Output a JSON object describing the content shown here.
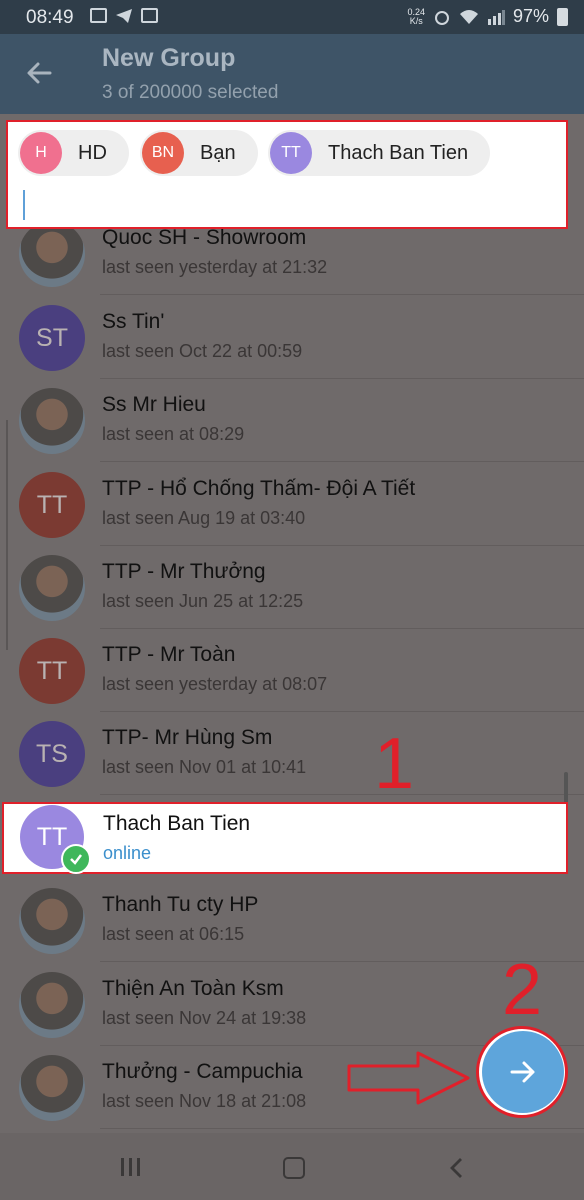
{
  "status_bar": {
    "time": "08:49",
    "speed_value": "0.24",
    "speed_unit": "K/s",
    "battery": "97%"
  },
  "app_bar": {
    "title": "New Group",
    "subtitle": "3 of 200000 selected"
  },
  "chips": [
    {
      "initials": "H",
      "label": "HD",
      "color": "#f0708f"
    },
    {
      "initials": "BN",
      "label": "Bạn",
      "color": "#e7604f"
    },
    {
      "initials": "TT",
      "label": "Thach Ban Tien",
      "color": "#9a88e0"
    }
  ],
  "contacts": [
    {
      "name": "Quoc SH - Showroom",
      "status": "last seen yesterday at 21:32",
      "avatar": "photo"
    },
    {
      "name": "Ss Tin'",
      "status": "last seen Oct 22 at 00:59",
      "initials": "ST",
      "color": "#4a3f7f"
    },
    {
      "name": "Ss Mr Hieu",
      "status": "last seen at 08:29",
      "avatar": "photo"
    },
    {
      "name": "TTP - Hổ Chống Thấm- Đội A Tiết",
      "status": "last seen Aug 19 at 03:40",
      "initials": "TT",
      "color": "#7b3a32"
    },
    {
      "name": "TTP - Mr Thưởng",
      "status": "last seen Jun 25 at 12:25",
      "avatar": "photo"
    },
    {
      "name": "TTP - Mr Toàn",
      "status": "last seen yesterday at 08:07",
      "initials": "TT",
      "color": "#7b3a32"
    },
    {
      "name": "TTP- Mr Hùng Sm",
      "status": "last seen Nov 01 at 10:41",
      "initials": "TS",
      "color": "#4a3f7f"
    }
  ],
  "selected_contact": {
    "name": "Thach Ban Tien",
    "status": "online",
    "initials": "TT"
  },
  "contacts_after": [
    {
      "name": "Thanh Tu cty HP",
      "status": "last seen at 06:15",
      "avatar": "photo"
    },
    {
      "name": "Thiện An Toàn Ksm",
      "status": "last seen Nov 24 at 19:38",
      "avatar": "photo"
    },
    {
      "name": "Thưởng - Campuchia",
      "status": "last seen Nov 18 at 21:08",
      "avatar": "photo"
    }
  ],
  "annotations": {
    "step1": "1",
    "step2": "2"
  },
  "colors": {
    "appbar": "#3e5467",
    "fab": "#5ea5db",
    "highlight": "#e0202a",
    "online": "#3b8fcc"
  }
}
